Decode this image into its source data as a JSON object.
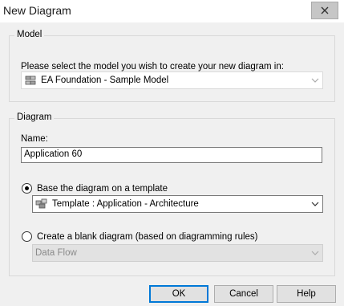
{
  "window": {
    "title": "New Diagram",
    "close_icon": "close-icon"
  },
  "model_group": {
    "legend": "Model",
    "prompt": "Please select the model you wish to create your new diagram in:",
    "selected_model": "EA Foundation - Sample Model",
    "model_icon": "model-icon"
  },
  "diagram_group": {
    "legend": "Diagram",
    "name_label": "Name:",
    "name_value": "Application 60",
    "template_option_label": "Base the diagram on a template",
    "template_option_checked": true,
    "template_value": "Template : Application - Architecture",
    "blank_option_label": "Create a blank diagram (based on diagramming rules)",
    "blank_option_checked": false,
    "blank_value": "Data Flow"
  },
  "buttons": {
    "ok": "OK",
    "cancel": "Cancel",
    "help": "Help"
  },
  "colors": {
    "focus_accent": "#0078d7",
    "dialog_background": "#f0f0f0"
  }
}
